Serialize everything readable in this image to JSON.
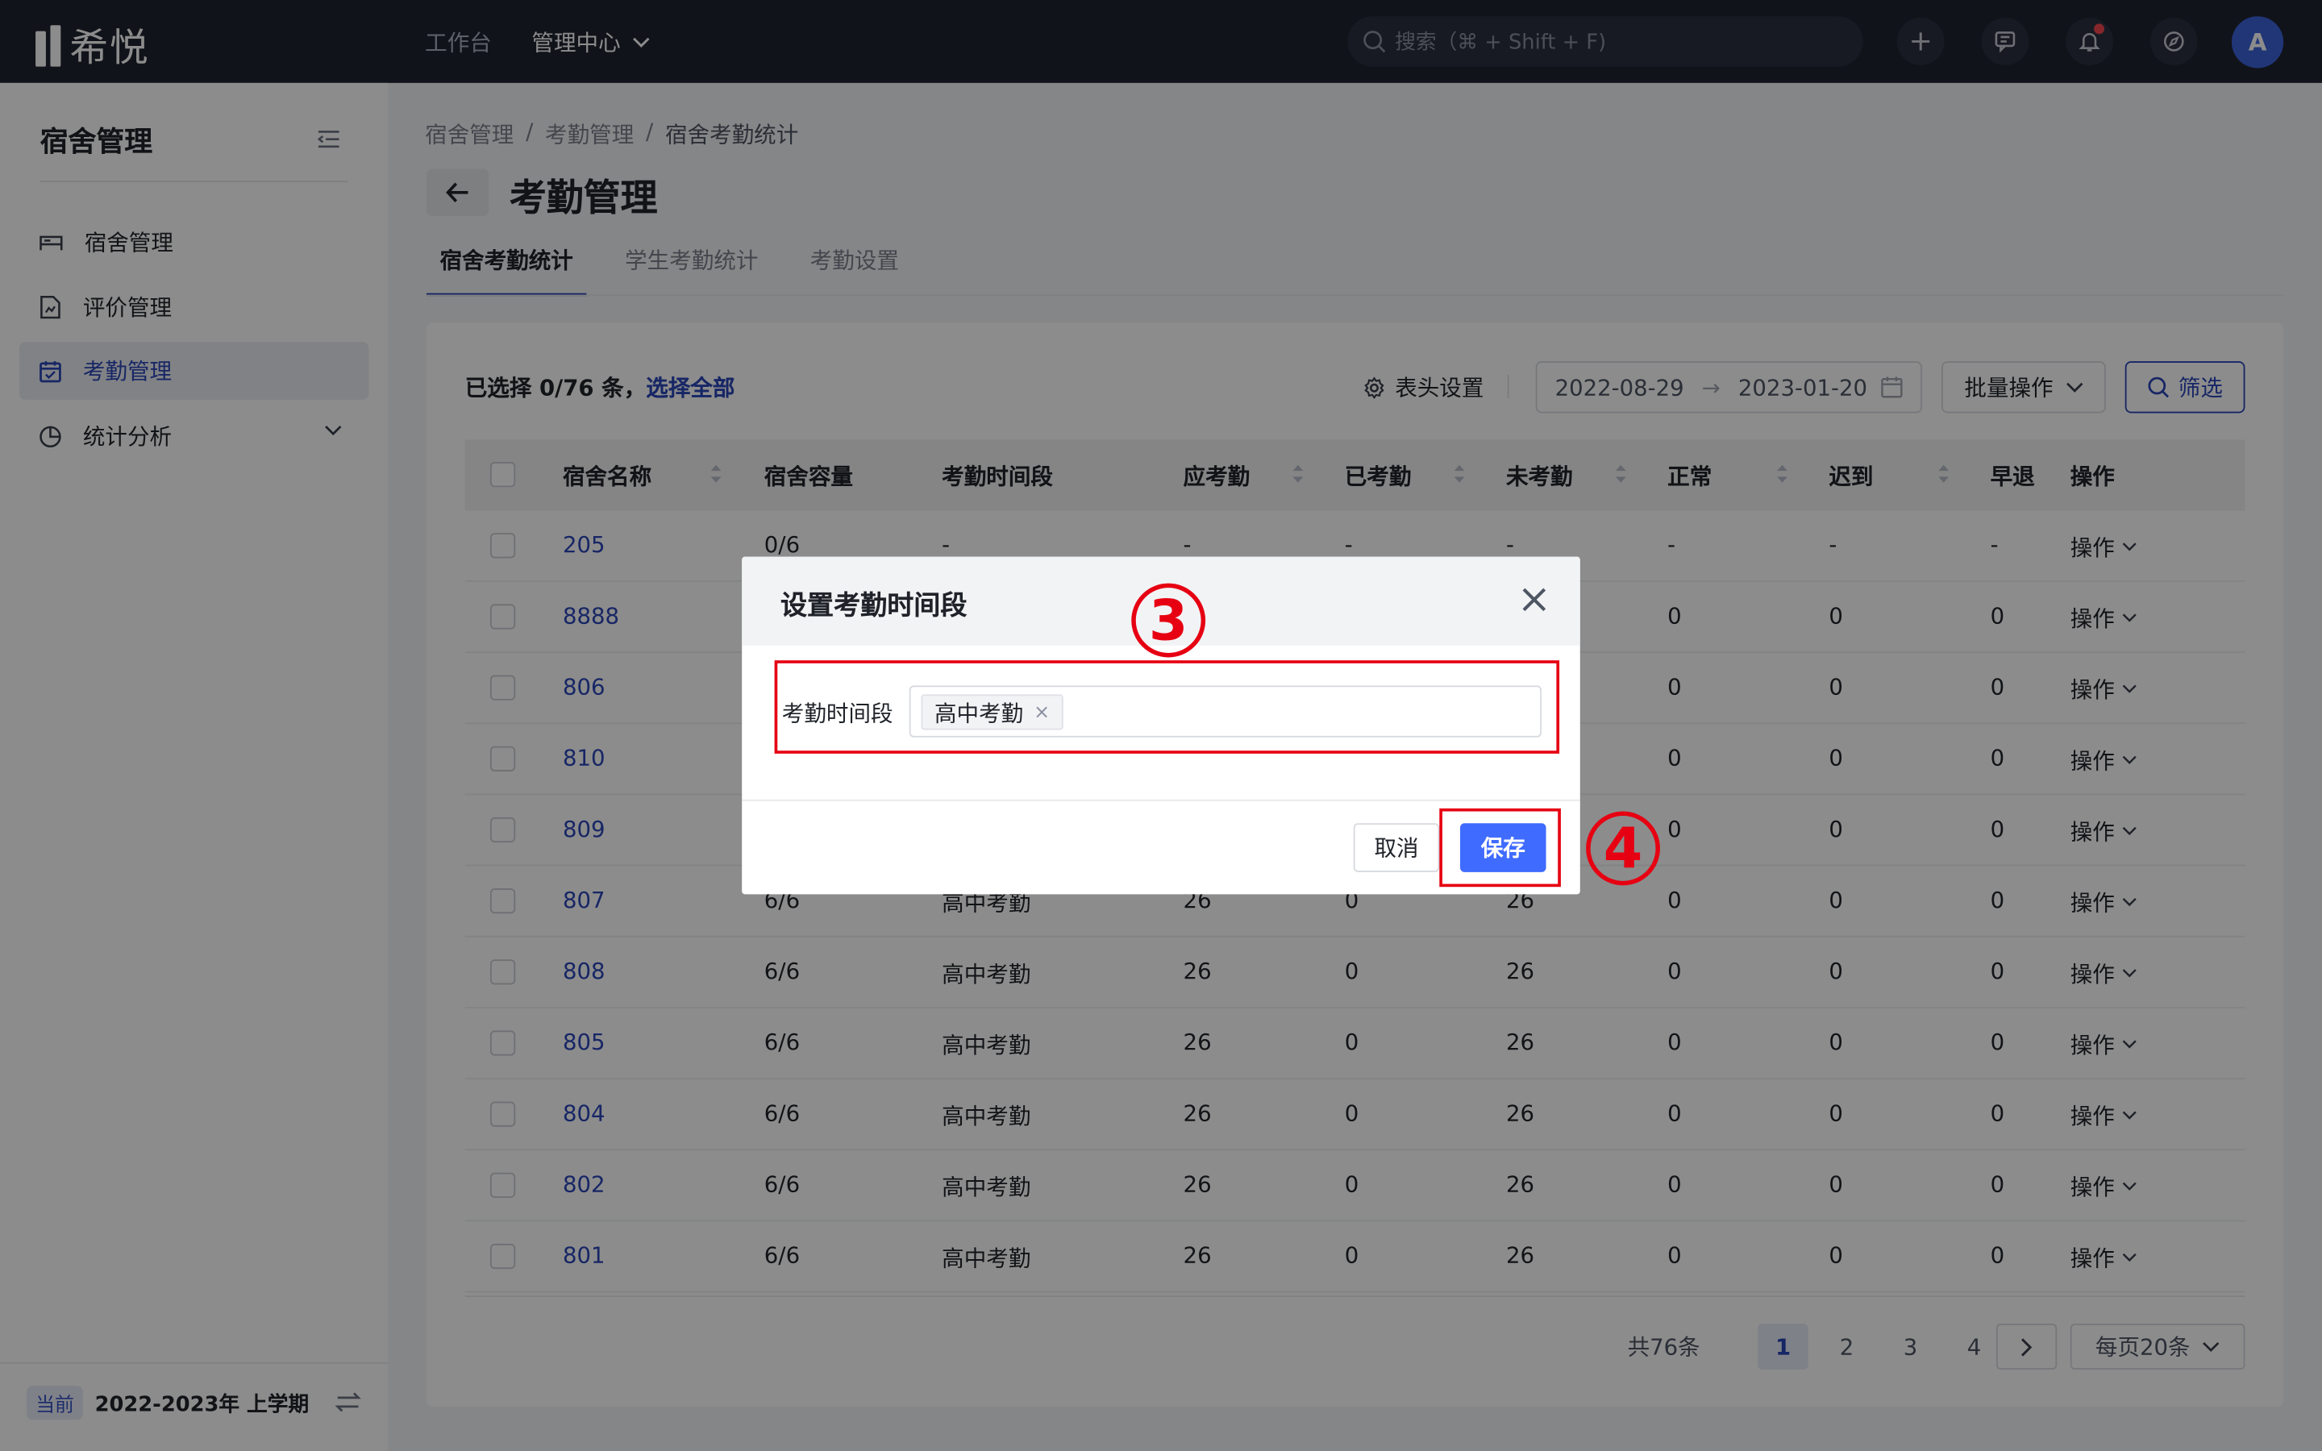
{
  "app": {
    "name": "希悦"
  },
  "topnav": {
    "workbench": "工作台",
    "admin_center": "管理中心"
  },
  "search": {
    "placeholder": "搜索（⌘ + Shift + F)"
  },
  "user": {
    "initial": "A"
  },
  "sidebar": {
    "title": "宿舍管理",
    "items": [
      {
        "label": "宿舍管理",
        "icon": "bed-icon"
      },
      {
        "label": "评价管理",
        "icon": "review-doc-icon"
      },
      {
        "label": "考勤管理",
        "icon": "calendar-icon",
        "active": true
      },
      {
        "label": "统计分析",
        "icon": "pie-chart-icon",
        "has_submenu": true
      }
    ],
    "footer": {
      "badge": "当前",
      "term": "2022-2023年 上学期"
    }
  },
  "breadcrumb": [
    "宿舍管理",
    "考勤管理",
    "宿舍考勤统计"
  ],
  "breadcrumb_sep": "/",
  "page_title": "考勤管理",
  "tabs": [
    "宿舍考勤统计",
    "学生考勤统计",
    "考勤设置"
  ],
  "toolbar": {
    "selected_text": "已选择 0/76 条，",
    "select_all": "选择全部",
    "column_settings": "表头设置",
    "date_start": "2022-08-29",
    "date_end": "2023-01-20",
    "date_arrow": "→",
    "batch": "批量操作",
    "filter": "筛选"
  },
  "table": {
    "columns": [
      "宿舍名称",
      "宿舍容量",
      "考勤时间段",
      "应考勤",
      "已考勤",
      "未考勤",
      "正常",
      "迟到",
      "早退",
      "操作"
    ],
    "op_label": "操作",
    "rows": [
      [
        "205",
        "0/6",
        "-",
        "-",
        "-",
        "-",
        "-",
        "-",
        "-"
      ],
      [
        "8888",
        "",
        "",
        "",
        "",
        "",
        "0",
        "0",
        "0"
      ],
      [
        "806",
        "",
        "",
        "",
        "",
        "",
        "0",
        "0",
        "0"
      ],
      [
        "810",
        "",
        "",
        "",
        "",
        "",
        "0",
        "0",
        "0"
      ],
      [
        "809",
        "",
        "",
        "",
        "",
        "",
        "0",
        "0",
        "0"
      ],
      [
        "807",
        "6/6",
        "高中考勤",
        "26",
        "0",
        "26",
        "0",
        "0",
        "0"
      ],
      [
        "808",
        "6/6",
        "高中考勤",
        "26",
        "0",
        "26",
        "0",
        "0",
        "0"
      ],
      [
        "805",
        "6/6",
        "高中考勤",
        "26",
        "0",
        "26",
        "0",
        "0",
        "0"
      ],
      [
        "804",
        "6/6",
        "高中考勤",
        "26",
        "0",
        "26",
        "0",
        "0",
        "0"
      ],
      [
        "802",
        "6/6",
        "高中考勤",
        "26",
        "0",
        "26",
        "0",
        "0",
        "0"
      ],
      [
        "801",
        "6/6",
        "高中考勤",
        "26",
        "0",
        "26",
        "0",
        "0",
        "0"
      ]
    ]
  },
  "pagination": {
    "total": "共76条",
    "pages": [
      "1",
      "2",
      "3",
      "4"
    ],
    "current": "1",
    "page_size": "每页20条"
  },
  "modal": {
    "title": "设置考勤时间段",
    "field_label": "考勤时间段",
    "tags": [
      "高中考勤"
    ],
    "tag_remove": "×",
    "cancel": "取消",
    "save": "保存"
  },
  "annotations": {
    "step3": "3",
    "step4": "4",
    "color": "#e60012"
  },
  "colors": {
    "topbar": "#1f2330",
    "accent": "#2b45b8",
    "primary_button": "#3f6bff"
  }
}
